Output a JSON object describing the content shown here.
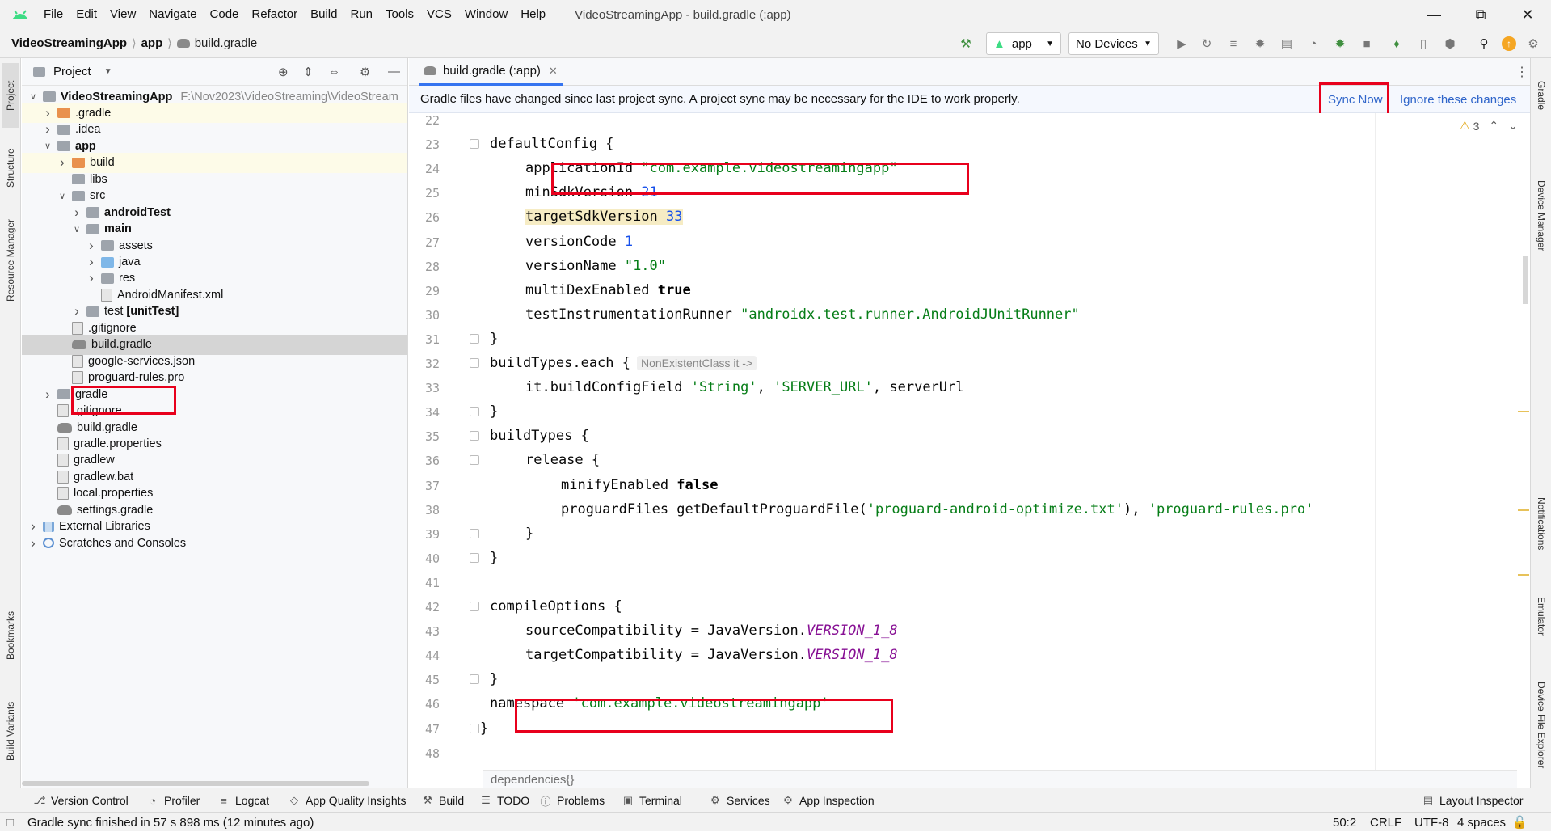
{
  "window": {
    "title": "VideoStreamingApp - build.gradle (:app)",
    "menu": [
      {
        "label": "File",
        "mn": "F",
        "rest": "ile"
      },
      {
        "label": "Edit",
        "mn": "E",
        "rest": "dit"
      },
      {
        "label": "View",
        "mn": "V",
        "rest": "iew"
      },
      {
        "label": "Navigate",
        "mn": "N",
        "rest": "avigate"
      },
      {
        "label": "Code",
        "mn": "C",
        "rest": "ode"
      },
      {
        "label": "Refactor",
        "mn": "R",
        "rest": "efactor"
      },
      {
        "label": "Build",
        "mn": "B",
        "rest": "uild"
      },
      {
        "label": "Run",
        "mn": "R",
        "rest": "un"
      },
      {
        "label": "Tools",
        "mn": "T",
        "rest": "ools"
      },
      {
        "label": "VCS",
        "mn": "V",
        "rest": "CS"
      },
      {
        "label": "Window",
        "mn": "W",
        "rest": "indow"
      },
      {
        "label": "Help",
        "mn": "H",
        "rest": "elp"
      }
    ]
  },
  "breadcrumb": {
    "project": "VideoStreamingApp",
    "module": "app",
    "file": "build.gradle"
  },
  "toolbar": {
    "run_config": "app",
    "device": "No Devices"
  },
  "project_panel": {
    "title": "Project",
    "root_path": "F:\\Nov2023\\VideoStreaming\\VideoStream",
    "tree": [
      {
        "label": "VideoStreamingApp",
        "depth": 0,
        "chev": "v",
        "icon": "folder",
        "bold": true,
        "path": true
      },
      {
        "label": ".gradle",
        "depth": 1,
        "chev": ">",
        "icon": "folder-orange",
        "bg": "yellow"
      },
      {
        "label": ".idea",
        "depth": 1,
        "chev": ">",
        "icon": "folder"
      },
      {
        "label": "app",
        "depth": 1,
        "chev": "v",
        "icon": "folder",
        "bold": true
      },
      {
        "label": "build",
        "depth": 2,
        "chev": ">",
        "icon": "folder-orange",
        "bg": "yellow"
      },
      {
        "label": "libs",
        "depth": 2,
        "chev": "",
        "icon": "folder"
      },
      {
        "label": "src",
        "depth": 2,
        "chev": "v",
        "icon": "folder"
      },
      {
        "label": "androidTest",
        "depth": 3,
        "chev": ">",
        "icon": "folder",
        "bold": true
      },
      {
        "label": "main",
        "depth": 3,
        "chev": "v",
        "icon": "folder",
        "bold": true
      },
      {
        "label": "assets",
        "depth": 4,
        "chev": ">",
        "icon": "folder"
      },
      {
        "label": "java",
        "depth": 4,
        "chev": ">",
        "icon": "folder-blue"
      },
      {
        "label": "res",
        "depth": 4,
        "chev": ">",
        "icon": "folder"
      },
      {
        "label": "AndroidManifest.xml",
        "depth": 4,
        "chev": "",
        "icon": "file"
      },
      {
        "label": "test",
        "suffix": "[unitTest]",
        "depth": 3,
        "chev": ">",
        "icon": "folder"
      },
      {
        "label": ".gitignore",
        "depth": 2,
        "chev": "",
        "icon": "file"
      },
      {
        "label": "build.gradle",
        "depth": 2,
        "chev": "",
        "icon": "gradle",
        "bg": "sel"
      },
      {
        "label": "google-services.json",
        "depth": 2,
        "chev": "",
        "icon": "file"
      },
      {
        "label": "proguard-rules.pro",
        "depth": 2,
        "chev": "",
        "icon": "file"
      },
      {
        "label": "gradle",
        "depth": 1,
        "chev": ">",
        "icon": "folder"
      },
      {
        "label": ".gitignore",
        "depth": 1,
        "chev": "",
        "icon": "file"
      },
      {
        "label": "build.gradle",
        "depth": 1,
        "chev": "",
        "icon": "gradle"
      },
      {
        "label": "gradle.properties",
        "depth": 1,
        "chev": "",
        "icon": "file"
      },
      {
        "label": "gradlew",
        "depth": 1,
        "chev": "",
        "icon": "file"
      },
      {
        "label": "gradlew.bat",
        "depth": 1,
        "chev": "",
        "icon": "file"
      },
      {
        "label": "local.properties",
        "depth": 1,
        "chev": "",
        "icon": "file"
      },
      {
        "label": "settings.gradle",
        "depth": 1,
        "chev": "",
        "icon": "gradle"
      },
      {
        "label": "External Libraries",
        "depth": 0,
        "chev": ">",
        "icon": "lib"
      },
      {
        "label": "Scratches and Consoles",
        "depth": 0,
        "chev": ">",
        "icon": "scratch"
      }
    ]
  },
  "left_tool_tabs": [
    "Project",
    "Structure",
    "Resource Manager",
    "Bookmarks",
    "Build Variants"
  ],
  "right_tool_tabs": [
    "Gradle",
    "Device Manager",
    "Notifications",
    "Emulator",
    "Device File Explorer"
  ],
  "editor": {
    "tab_label": "build.gradle (:app)",
    "banner": {
      "message": "Gradle files have changed since last project sync. A project sync may be necessary for the IDE to work properly.",
      "sync_now": "Sync Now",
      "ignore": "Ignore these changes"
    },
    "warnings_count": "3",
    "line_numbers": [
      "22",
      "23",
      "24",
      "25",
      "26",
      "27",
      "28",
      "29",
      "30",
      "31",
      "32",
      "33",
      "34",
      "35",
      "36",
      "37",
      "38",
      "39",
      "40",
      "41",
      "42",
      "43",
      "44",
      "45",
      "46",
      "47",
      "48"
    ],
    "code_lines": [
      [],
      [
        {
          "t": "defaultConfig {"
        }
      ],
      [
        {
          "t": "applicationId "
        },
        {
          "t": "\"com.example.videostreamingapp\"",
          "c": "str"
        }
      ],
      [
        {
          "t": "minSdkVersion "
        },
        {
          "t": "21",
          "c": "num"
        }
      ],
      [
        {
          "t": "targetSdkVersion",
          "c": "hl-warn"
        },
        {
          "t": " ",
          "c": "hl-warn"
        },
        {
          "t": "33",
          "c": "num hl-warn"
        }
      ],
      [
        {
          "t": "versionCode "
        },
        {
          "t": "1",
          "c": "num"
        }
      ],
      [
        {
          "t": "versionName "
        },
        {
          "t": "\"1.0\"",
          "c": "str"
        }
      ],
      [
        {
          "t": "multiDexEnabled "
        },
        {
          "t": "true",
          "c": "kwb"
        }
      ],
      [
        {
          "t": "testInstrumentationRunner "
        },
        {
          "t": "\"androidx.test.runner.AndroidJUnitRunner\"",
          "c": "str"
        }
      ],
      [
        {
          "t": "}"
        }
      ],
      [
        {
          "t": "buildTypes.each {"
        },
        {
          "t": "NonExistentClass it ->",
          "c": "hint"
        }
      ],
      [
        {
          "t": "it.buildConfigField "
        },
        {
          "t": "'String'",
          "c": "str"
        },
        {
          "t": ", "
        },
        {
          "t": "'SERVER_URL'",
          "c": "str"
        },
        {
          "t": ", serverUrl"
        }
      ],
      [
        {
          "t": "}"
        }
      ],
      [
        {
          "t": "buildTypes {"
        }
      ],
      [
        {
          "t": "release {"
        }
      ],
      [
        {
          "t": "minifyEnabled "
        },
        {
          "t": "false",
          "c": "kwb"
        }
      ],
      [
        {
          "t": "proguardFiles getDefaultProguardFile("
        },
        {
          "t": "'proguard-android-optimize.txt'",
          "c": "str"
        },
        {
          "t": "), "
        },
        {
          "t": "'proguard-rules.pro'",
          "c": "str"
        }
      ],
      [
        {
          "t": "}"
        }
      ],
      [
        {
          "t": "}"
        }
      ],
      [],
      [
        {
          "t": "compileOptions {"
        }
      ],
      [
        {
          "t": "sourceCompatibility = JavaVersion."
        },
        {
          "t": "VERSION_1_8",
          "c": "ital"
        }
      ],
      [
        {
          "t": "targetCompatibility = JavaVersion."
        },
        {
          "t": "VERSION_1_8",
          "c": "ital"
        }
      ],
      [
        {
          "t": "}"
        }
      ],
      [
        {
          "t": "namespace "
        },
        {
          "t": "'com.example.videostreamingapp'",
          "c": "str"
        }
      ],
      [
        {
          "t": "}"
        }
      ],
      []
    ],
    "sticky_footer": "dependencies{}"
  },
  "tool_windows": [
    "Version Control",
    "Profiler",
    "Logcat",
    "App Quality Insights",
    "Build",
    "TODO",
    "Problems",
    "Terminal",
    "Services",
    "App Inspection"
  ],
  "layout_inspector": "Layout Inspector",
  "status": {
    "message": "Gradle sync finished in 57 s 898 ms (12 minutes ago)",
    "position": "50:2",
    "line_ending": "CRLF",
    "encoding": "UTF-8",
    "indent": "4 spaces"
  },
  "colors": {
    "accent": "#3574f0",
    "annotation_box": "#e8001c",
    "string": "#067d17",
    "number": "#1750eb"
  }
}
